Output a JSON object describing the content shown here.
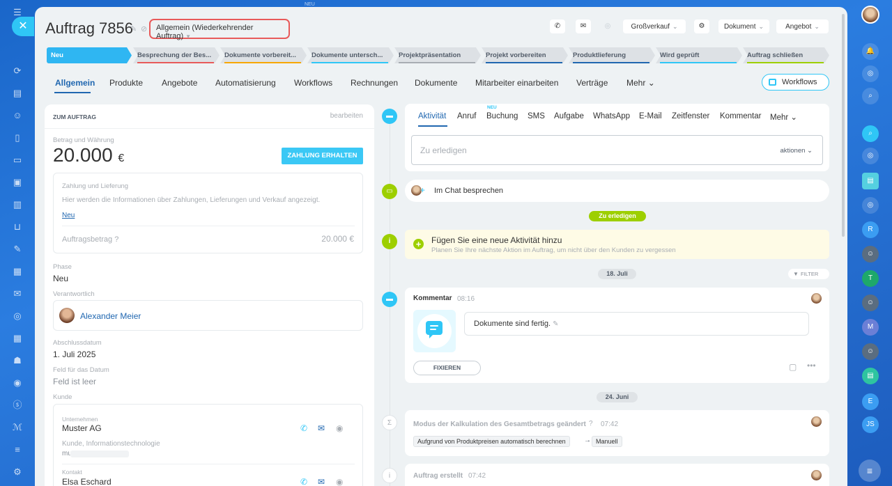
{
  "top_mark": "NEU",
  "header": {
    "title": "Auftrag 7856",
    "category": "Allgemein (Wiederkehrender Auftrag)",
    "buttons": {
      "grossverkauf": "Großverkauf",
      "dokument": "Dokument",
      "angebot": "Angebot"
    }
  },
  "stages": [
    {
      "label": "Neu",
      "color": "#2fb6f2",
      "active": true
    },
    {
      "label": "Besprechung der Bes...",
      "color": "#e85a5a"
    },
    {
      "label": "Dokumente vorbereit...",
      "color": "#f7a700"
    },
    {
      "label": "Dokumente untersch...",
      "color": "#2fc6f6"
    },
    {
      "label": "Projektpräsentation",
      "color": "#a8adb3"
    },
    {
      "label": "Projekt vorbereiten",
      "color": "#2067b0"
    },
    {
      "label": "Produktlieferung",
      "color": "#2067b0"
    },
    {
      "label": "Wird geprüft",
      "color": "#2fc6f6"
    },
    {
      "label": "Auftrag schließen",
      "color": "#9dcf00"
    }
  ],
  "tabs": [
    "Allgemein",
    "Produkte",
    "Angebote",
    "Automatisierung",
    "Workflows",
    "Rechnungen",
    "Dokumente",
    "Mitarbeiter einarbeiten",
    "Verträge",
    "Mehr"
  ],
  "workflows_button": "Workflows",
  "left": {
    "section_title": "ZUM AUFTRAG",
    "edit": "bearbeiten",
    "amount_label": "Betrag und Währung",
    "amount": "20.000",
    "currency": "€",
    "pay_button": "ZAHLUNG ERHALTEN",
    "payment_title": "Zahlung und Lieferung",
    "payment_desc": "Hier werden die Informationen über Zahlungen, Lieferungen und Verkauf angezeigt.",
    "payment_link": "Neu",
    "order_amount_label": "Auftragsbetrag",
    "order_amount": "20.000 €",
    "phase_label": "Phase",
    "phase": "Neu",
    "responsible_label": "Verantwortlich",
    "responsible": "Alexander Meier",
    "close_date_label": "Abschlussdatum",
    "close_date": "1. Juli 2025",
    "date_field_label": "Feld für das Datum",
    "date_field": "Feld ist leer",
    "customer_label": "Kunde",
    "company_label": "Unternehmen",
    "company": "Muster AG",
    "company_info": "Kunde, Informationstechnologie",
    "company_email": "mu",
    "contact_label": "Kontakt",
    "contact": "Elsa Eschard"
  },
  "activity": {
    "tabs": [
      "Aktivität",
      "Anruf",
      "Buchung",
      "SMS",
      "Aufgabe",
      "WhatsApp",
      "E-Mail",
      "Zeitfenster",
      "Kommentar",
      "Mehr"
    ],
    "new_badge": "NEU",
    "todo_placeholder": "Zu erledigen",
    "actions": "aktionen",
    "chat": "Im Chat besprechen",
    "todo_pill": "Zu erledigen",
    "add_title": "Fügen Sie eine neue Aktivität hinzu",
    "add_desc": "Planen Sie Ihre nächste Aktion im Auftrag, um nicht über den Kunden zu vergessen",
    "date1": "18. Juli",
    "filter": "FILTER",
    "comment_title": "Kommentar",
    "comment_time": "08:16",
    "comment_text": "Dokumente sind fertig.",
    "fix_button": "FIXIEREN",
    "date2": "24. Juni",
    "calc_title": "Modus der Kalkulation des Gesamtbetrags geändert",
    "calc_time": "07:42",
    "calc_from": "Aufgrund von Produktpreisen automatisch berechnen",
    "calc_to": "Manuell",
    "created_title": "Auftrag erstellt",
    "created_time": "07:42"
  },
  "right_rail": [
    "R",
    "T",
    "M",
    "E",
    "JS"
  ],
  "colors": {
    "accent": "#2fc6f6",
    "link": "#2067b0",
    "green": "#9dcf00",
    "highlight": "#e85a5a"
  }
}
